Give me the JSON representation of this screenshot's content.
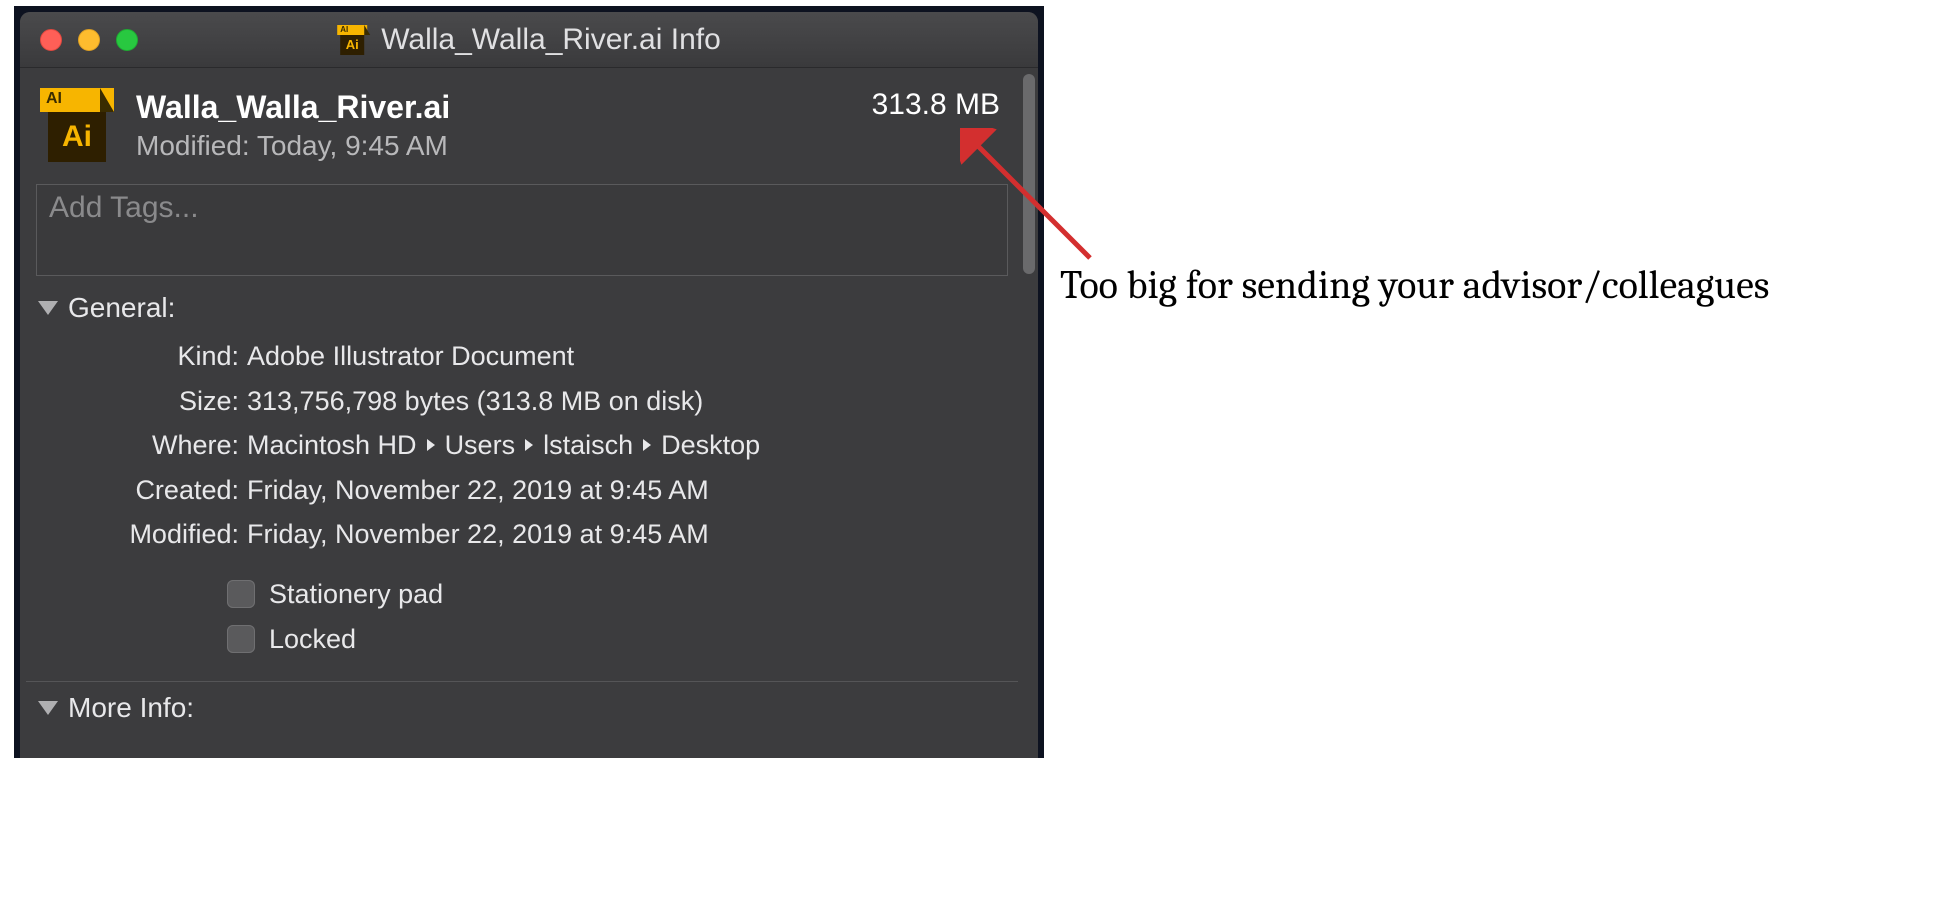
{
  "window": {
    "title": "Walla_Walla_River.ai Info"
  },
  "file": {
    "name": "Walla_Walla_River.ai",
    "size_display": "313.8 MB",
    "modified_summary": "Modified: Today, 9:45 AM"
  },
  "tags": {
    "placeholder": "Add Tags..."
  },
  "sections": {
    "general": {
      "title": "General:",
      "kind_label": "Kind:",
      "kind_value": "Adobe Illustrator Document",
      "size_label": "Size:",
      "size_value": "313,756,798 bytes (313.8 MB on disk)",
      "where_label": "Where:",
      "where_parts": [
        "Macintosh HD",
        "Users",
        "lstaisch",
        "Desktop"
      ],
      "created_label": "Created:",
      "created_value": "Friday, November 22, 2019 at 9:45 AM",
      "modified_label": "Modified:",
      "modified_value": "Friday, November 22, 2019 at 9:45 AM",
      "stationery_label": "Stationery pad",
      "locked_label": "Locked"
    },
    "more_info": {
      "title": "More Info:"
    }
  },
  "annotation": {
    "text": "Too big for sending your advisor/colleagues"
  }
}
